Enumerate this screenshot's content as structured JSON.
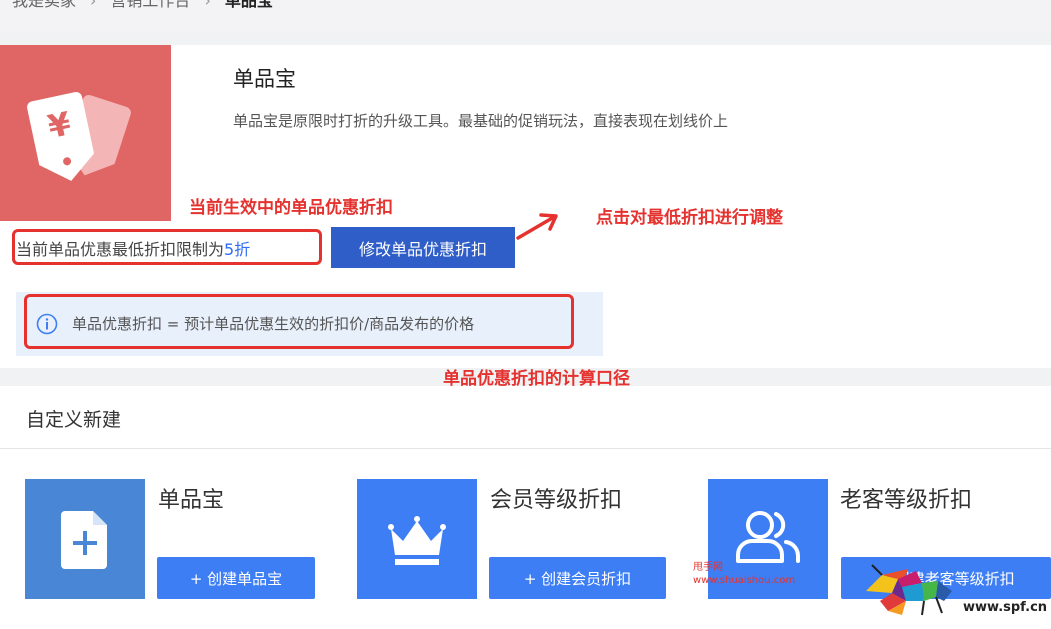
{
  "breadcrumb": {
    "items": [
      "我是卖家",
      "营销工作台"
    ],
    "current": "单品宝"
  },
  "colors": {
    "hero": "#e06666",
    "primary_button": "#2f5ec8",
    "card_blue": "#3d7ef5",
    "annotation_red": "#e5322e",
    "info_bg": "#e8f0fb"
  },
  "product": {
    "title": "单品宝",
    "description": "单品宝是原限时打折的升级工具。最基础的促销玩法，直接表现在划线价上",
    "icon": "price-tag-icon"
  },
  "discount": {
    "limit_label": "当前单品优惠最低折扣限制为",
    "limit_value": "5折",
    "modify_button": "修改单品优惠折扣"
  },
  "info": {
    "icon": "info-circle-icon",
    "formula": "单品优惠折扣 = 预计单品优惠生效的折扣价/商品发布的价格"
  },
  "annotations": {
    "current_discount": "当前生效中的单品优惠折扣",
    "click_adjust": "点击对最低折扣进行调整",
    "calc_basis": "单品优惠折扣的计算口径"
  },
  "custom_section": {
    "title": "自定义新建",
    "cards": [
      {
        "name": "单品宝",
        "button": "+ 创建单品宝",
        "icon": "document-add-icon"
      },
      {
        "name": "会员等级折扣",
        "button": "+ 创建会员折扣",
        "icon": "crown-icon"
      },
      {
        "name": "老客等级折扣",
        "button": "+ 创建老客等级折扣",
        "icon": "users-icon"
      }
    ]
  },
  "watermark": {
    "small_title": "甩手网",
    "small_url": "www.shuaishou.com",
    "logo_url": "www.spf.cn",
    "logo_icon": "colorful-bull-logo-icon"
  }
}
